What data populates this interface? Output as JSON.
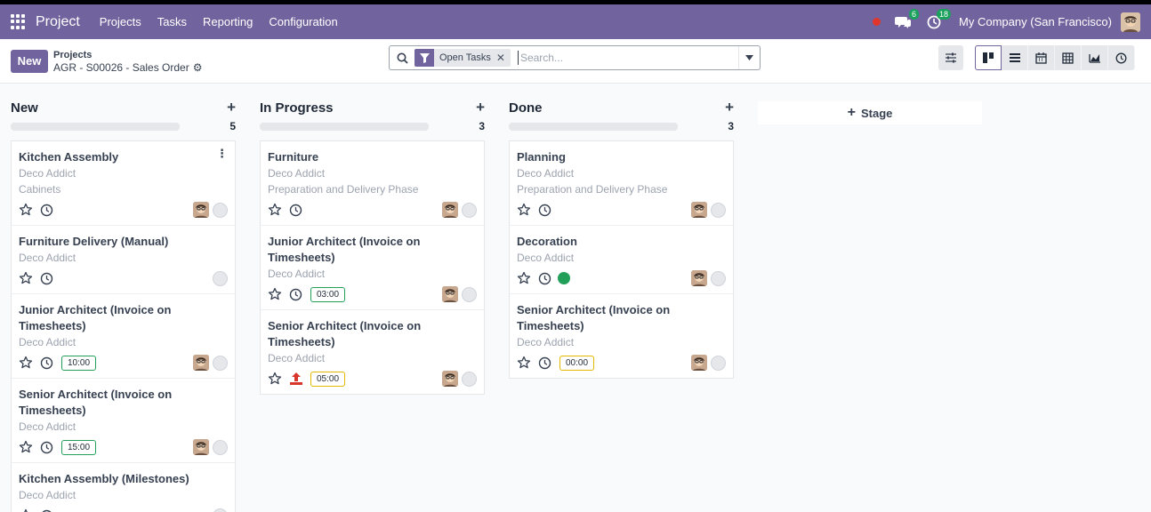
{
  "nav": {
    "app_name": "Project",
    "menu": [
      "Projects",
      "Tasks",
      "Reporting",
      "Configuration"
    ],
    "messages_count": "6",
    "activities_count": "18",
    "company": "My Company (San Francisco)"
  },
  "control": {
    "new_label": "New",
    "breadcrumb_parent": "Projects",
    "breadcrumb_current": "AGR - S00026 - Sales Order",
    "facet_label": "Open Tasks",
    "search_placeholder": "Search..."
  },
  "colors": {
    "brand": "#71639e",
    "badge": "#1aa15b",
    "timer_ok": "#22a05a",
    "timer_warn": "#e5b800"
  },
  "columns": [
    {
      "title": "New",
      "count": "5",
      "cards": [
        {
          "title": "Kitchen Assembly",
          "lines": [
            "Deco Addict",
            "Cabinets"
          ],
          "timer": "",
          "avatar": true
        },
        {
          "title": "Furniture Delivery (Manual)",
          "lines": [
            "Deco Addict"
          ],
          "timer": "",
          "avatar": false
        },
        {
          "title": "Junior Architect (Invoice on Timesheets)",
          "lines": [
            "Deco Addict"
          ],
          "timer": "10:00",
          "avatar": true
        },
        {
          "title": "Senior Architect (Invoice on Timesheets)",
          "lines": [
            "Deco Addict"
          ],
          "timer": "15:00",
          "avatar": true
        },
        {
          "title": "Kitchen Assembly (Milestones)",
          "lines": [
            "Deco Addict"
          ],
          "timer": "",
          "avatar": false
        }
      ]
    },
    {
      "title": "In Progress",
      "count": "3",
      "cards": [
        {
          "title": "Furniture",
          "lines": [
            "Deco Addict",
            "Preparation and Delivery Phase"
          ],
          "timer": "",
          "avatar": true
        },
        {
          "title": "Junior Architect (Invoice on Timesheets)",
          "lines": [
            "Deco Addict"
          ],
          "timer": "03:00",
          "avatar": true
        },
        {
          "title": "Senior Architect (Invoice on Timesheets)",
          "lines": [
            "Deco Addict"
          ],
          "timer": "05:00",
          "avatar": true
        }
      ]
    },
    {
      "title": "Done",
      "count": "3",
      "cards": [
        {
          "title": "Planning",
          "lines": [
            "Deco Addict",
            "Preparation and Delivery Phase"
          ],
          "timer": "",
          "avatar": true
        },
        {
          "title": "Decoration",
          "lines": [
            "Deco Addict"
          ],
          "timer": "",
          "avatar": true
        },
        {
          "title": "Senior Architect (Invoice on Timesheets)",
          "lines": [
            "Deco Addict"
          ],
          "timer": "00:00",
          "avatar": true
        }
      ]
    }
  ],
  "add_stage_label": "Stage"
}
